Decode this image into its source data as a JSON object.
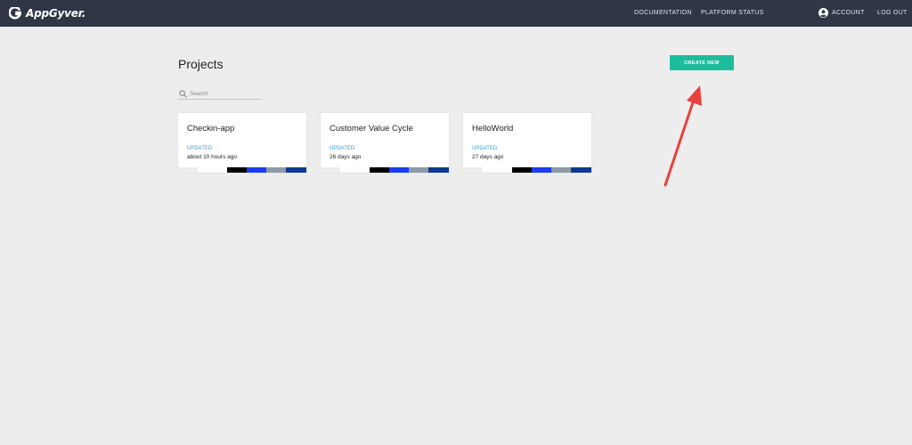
{
  "header": {
    "brand": "AppGyver.",
    "nav": {
      "documentation": "DOCUMENTATION",
      "platform_status": "PLATFORM STATUS",
      "account": "ACCOUNT",
      "logout": "LOG OUT"
    }
  },
  "main": {
    "title": "Projects",
    "create_label": "CREATE NEW",
    "search": {
      "placeholder": "Search",
      "value": ""
    }
  },
  "projects": [
    {
      "name": "Checkin-app",
      "updated_label": "UPDATED",
      "updated_time": "about 10 hours ago"
    },
    {
      "name": "Customer Value Cycle",
      "updated_label": "UPDATED",
      "updated_time": "26 days ago"
    },
    {
      "name": "HelloWorld",
      "updated_label": "UPDATED",
      "updated_time": "27 days ago"
    }
  ],
  "palette": [
    "#eeeeee",
    "#ffffff",
    "#000000",
    "#1a3cf5",
    "#8e9aa6",
    "#0d3a8c"
  ],
  "colors": {
    "topbar": "#2f3646",
    "accent": "#1dbc9c",
    "updated_label": "#2f9fd8",
    "annotation_arrow": "#e8413c"
  }
}
